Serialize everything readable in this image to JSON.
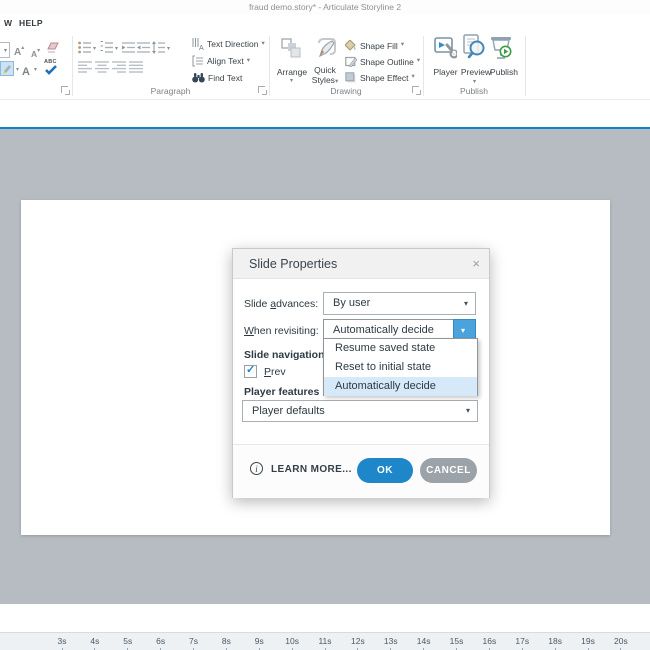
{
  "window": {
    "title": "fraud demo.story* - Articulate Storyline 2"
  },
  "menu": {
    "items": [
      {
        "label": "W"
      },
      {
        "label": "HELP"
      }
    ]
  },
  "ribbon": {
    "paragraph": {
      "group_label": "Paragraph",
      "text_direction": "Text Direction",
      "align_text": "Align Text",
      "find_text": "Find Text"
    },
    "drawing": {
      "group_label": "Drawing",
      "arrange": "Arrange",
      "quick_line1": "Quick",
      "quick_line2": "Styles",
      "shape_fill": "Shape Fill",
      "shape_outline": "Shape Outline",
      "shape_effect": "Shape Effect"
    },
    "publish_group": {
      "group_label": "Publish",
      "player": "Player",
      "preview": "Preview",
      "publish": "Publish"
    }
  },
  "dialog": {
    "title": "Slide Properties",
    "close": "×",
    "slide_advances": {
      "pre": "Slide ",
      "key": "a",
      "post": "dvances:",
      "value": "By user"
    },
    "when_revisiting": {
      "pre": "",
      "key": "W",
      "post": "hen revisiting:",
      "value": "Automatically decide"
    },
    "dropdown_options": [
      "Resume saved state",
      "Reset to initial state",
      "Automatically decide"
    ],
    "selected_option": "Automatically decide",
    "slide_navigation_label": "Slide navigation c",
    "prev": {
      "key": "P",
      "post": "rev",
      "checked": "✓"
    },
    "player_features_label": "Player features",
    "player_defaults_value": "Player defaults",
    "learn_more": "LEARN MORE...",
    "ok": "OK",
    "cancel": "CANCEL"
  },
  "timeline": {
    "labels": [
      "3s",
      "4s",
      "5s",
      "6s",
      "7s",
      "8s",
      "9s",
      "10s",
      "11s",
      "12s",
      "13s",
      "14s",
      "15s",
      "16s",
      "17s",
      "18s",
      "19s",
      "20s"
    ]
  },
  "colors": {
    "accent_blue_line": "#0f82c8",
    "ok_blue": "#1d87ca",
    "cancel_gray": "#9ba2a8",
    "dropdown_button_blue": "#4aa3dd",
    "highlight_row_blue": "#d6e9f8",
    "canvas_gray": "#b6bcc2"
  }
}
